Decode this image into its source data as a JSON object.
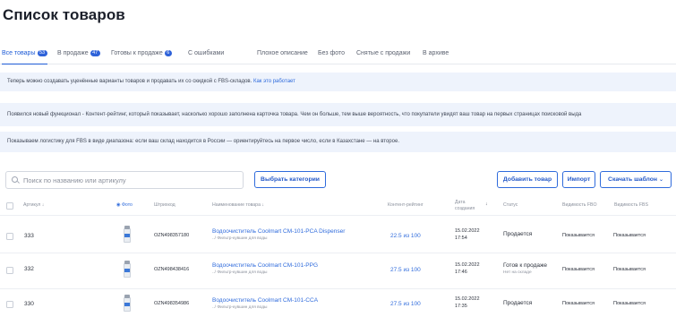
{
  "page": {
    "title": "Список товаров"
  },
  "tabs": [
    {
      "label": "Все товары",
      "badge": "53"
    },
    {
      "label": "В продаже",
      "badge": "47"
    },
    {
      "label": "Готовы к продаже",
      "badge": "6"
    },
    {
      "label": "С ошибками"
    },
    {
      "label": "Плохое описание"
    },
    {
      "label": "Без фото"
    },
    {
      "label": "Снятые с продажи"
    },
    {
      "label": "В архиве"
    }
  ],
  "notices": [
    {
      "text": "Теперь можно создавать уценённые варианты товаров и продавать их со скидкой с FBS-складов.",
      "link": "Как это работает"
    },
    {
      "text": "Появился новый функционал - Контент-рейтинг, который показывает, насколько хорошо заполнена карточка товара. Чем он больше, тем выше вероятность, что покупатели увидят ваш товар на первых страницах поисковой выда"
    },
    {
      "text": "Показываем логистику для FBS в виде диапазона: если ваш склад находится в России — ориентируйтесь на первое число, если в Казахстане — на второе."
    }
  ],
  "toolbar": {
    "search_placeholder": "Поиск по названию или артикулу",
    "categories_label": "Выбрать категории",
    "add_label": "Добавить товар",
    "import_label": "Импорт",
    "download_label": "Скачать шаблон"
  },
  "table": {
    "headers": {
      "article": "Артикул",
      "photo": "Фото",
      "barcode": "Штрихкод",
      "name": "Наименование товара",
      "rating": "Контент-рейтинг",
      "date_line1": "Дата",
      "date_line2": "создания",
      "status": "Статус",
      "fbo": "Видимость FBO",
      "fbs": "Видимость FBS"
    },
    "rows": [
      {
        "article": "333",
        "barcode": "OZN498357180",
        "name": "Водоочиститель Coolmart CM-101-PCA Dispenser",
        "category": "../ Фильтр-кувшин для воды",
        "rating": "22.5 из 100",
        "date": "15.02.2022",
        "time": "17:54",
        "status": "Продается",
        "status_sub": "",
        "fbo": "Показывается",
        "fbs": "Показывается"
      },
      {
        "article": "332",
        "barcode": "OZN498438416",
        "name": "Водоочиститель Coolmart CM-101-PPG",
        "category": "../ Фильтр-кувшин для воды",
        "rating": "27.5 из 100",
        "date": "15.02.2022",
        "time": "17:46",
        "status": "Готов к продаже",
        "status_sub": "Нет на складе",
        "fbo": "Показывается",
        "fbs": "Показывается"
      },
      {
        "article": "330",
        "barcode": "OZN498354986",
        "name": "Водоочиститель Coolmart CM-101-CCA",
        "category": "../ Фильтр-кувшин для воды",
        "rating": "27.5 из 100",
        "date": "15.02.2022",
        "time": "17:35",
        "status": "Продается",
        "status_sub": "",
        "fbo": "Показывается",
        "fbs": "Показывается"
      }
    ]
  },
  "colors": {
    "accent": "#2f6bdc",
    "notice_bg": "#eef3fc",
    "badge": "#2e62d9"
  }
}
